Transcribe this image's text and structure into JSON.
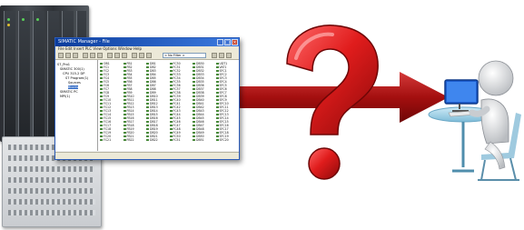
{
  "window": {
    "title": "SIMATIC Manager - File",
    "menu": "File  Edit  Insert  PLC  View  Options  Window  Help",
    "path": "< No Filter >",
    "status": ""
  },
  "tree": [
    "S7_Pro1",
    "SIMATIC 300(1)",
    "CPU 315-2 DP",
    "S7 Program(1)",
    "Sources",
    "Blocks",
    "SIMATIC PC",
    "MPI(1)"
  ],
  "list_columns": [
    [
      "OB1",
      "FC1",
      "FC2",
      "FC3",
      "FC4",
      "FC5",
      "FC6",
      "FC7",
      "FC8",
      "FC9",
      "FC10",
      "FC11",
      "FC12",
      "FC13",
      "FC14",
      "FC15",
      "FC16",
      "FC17",
      "FC18",
      "FC19",
      "FC20",
      "FC21"
    ],
    [
      "FB1",
      "FB2",
      "FB3",
      "FB4",
      "FB5",
      "FB6",
      "FB7",
      "FB8",
      "FB9",
      "FB10",
      "FB11",
      "FB12",
      "FB13",
      "FB14",
      "FB15",
      "FB16",
      "FB17",
      "FB18",
      "FB19",
      "FB20",
      "FB21",
      "FB22"
    ],
    [
      "DB1",
      "DB2",
      "DB3",
      "DB4",
      "DB5",
      "DB6",
      "DB7",
      "DB8",
      "DB9",
      "DB10",
      "DB11",
      "DB12",
      "DB13",
      "DB14",
      "DB15",
      "DB16",
      "DB17",
      "DB18",
      "DB19",
      "DB20",
      "DB21",
      "DB22"
    ],
    [
      "FC30",
      "FC31",
      "FC32",
      "FC33",
      "FC34",
      "FC35",
      "FC36",
      "FC37",
      "FC38",
      "FC39",
      "FC40",
      "FC41",
      "FC42",
      "FC43",
      "FC44",
      "FC45",
      "FC46",
      "FC47",
      "FC48",
      "FC49",
      "FC50",
      "FC51"
    ],
    [
      "DB30",
      "DB31",
      "DB32",
      "DB33",
      "DB34",
      "DB35",
      "DB36",
      "DB37",
      "DB38",
      "DB39",
      "DB40",
      "DB41",
      "DB42",
      "DB43",
      "DB44",
      "DB45",
      "DB46",
      "DB47",
      "DB48",
      "DB49",
      "DB50",
      "DB51"
    ],
    [
      "UDT1",
      "VAT1",
      "SFC1",
      "SFC2",
      "SFC3",
      "SFC4",
      "SFC5",
      "SFC6",
      "SFC7",
      "SFC8",
      "SFC9",
      "SFC10",
      "SFC11",
      "SFC12",
      "SFC13",
      "SFC14",
      "SFC15",
      "SFC16",
      "SFC17",
      "SFC18",
      "SFC19",
      "SFC20"
    ]
  ],
  "colors": {
    "arrow": "#b01010",
    "question_mark": "#d81818",
    "titlebar": "#0a3c9c",
    "monitor": "#1f5fd0",
    "desk": "#9fd0e8"
  },
  "icons": [
    "plc-rack",
    "plc-module",
    "question-mark",
    "arrow-right",
    "person-at-computer"
  ]
}
